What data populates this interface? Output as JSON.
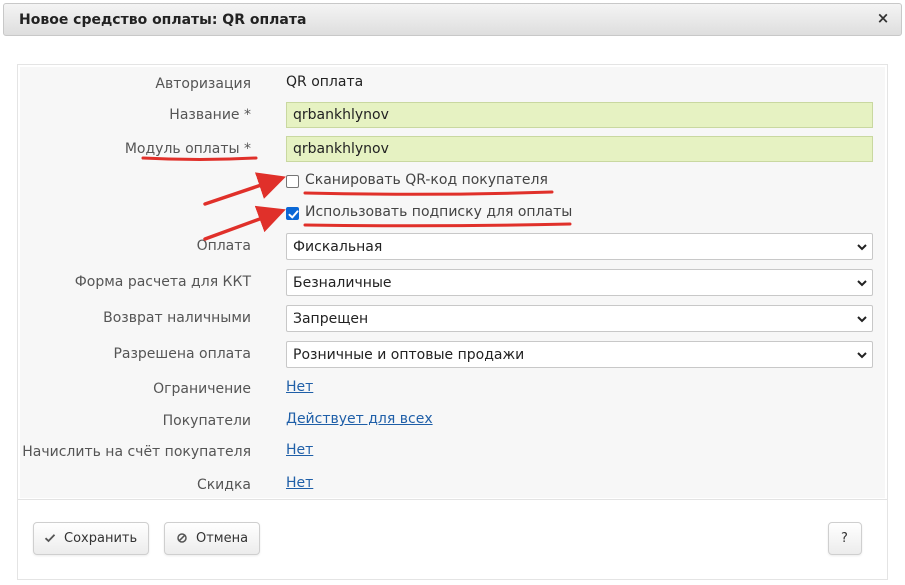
{
  "dialog": {
    "title": "Новое средство оплаты: QR оплата",
    "close_glyph": "×"
  },
  "form": {
    "auth_label": "Авторизация",
    "auth_value": "QR оплата",
    "name_label": "Название *",
    "name_value": "qrbankhlynov",
    "module_label": "Модуль оплаты *",
    "module_value": "qrbankhlynov",
    "scan_qr_label": "Сканировать QR-код покупателя",
    "scan_qr_checked": false,
    "subscription_label": "Использовать подписку для оплаты",
    "subscription_checked": true,
    "payment_label": "Оплата",
    "payment_value": "Фискальная",
    "kkt_label": "Форма расчета для ККТ",
    "kkt_value": "Безналичные",
    "cash_return_label": "Возврат наличными",
    "cash_return_value": "Запрещен",
    "allowed_label": "Разрешена оплата",
    "allowed_value": "Розничные и оптовые продажи",
    "restriction_label": "Ограничение",
    "restriction_value": "Нет",
    "buyers_label": "Покупатели",
    "buyers_value": "Действует для всех",
    "credit_label": "Начислить на счёт покупателя",
    "credit_value": "Нет",
    "discount_label": "Скидка",
    "discount_value": "Нет"
  },
  "footer": {
    "save_label": "Сохранить",
    "cancel_label": "Отмена",
    "help_label": "?"
  },
  "annotation_color": "#e0302a"
}
